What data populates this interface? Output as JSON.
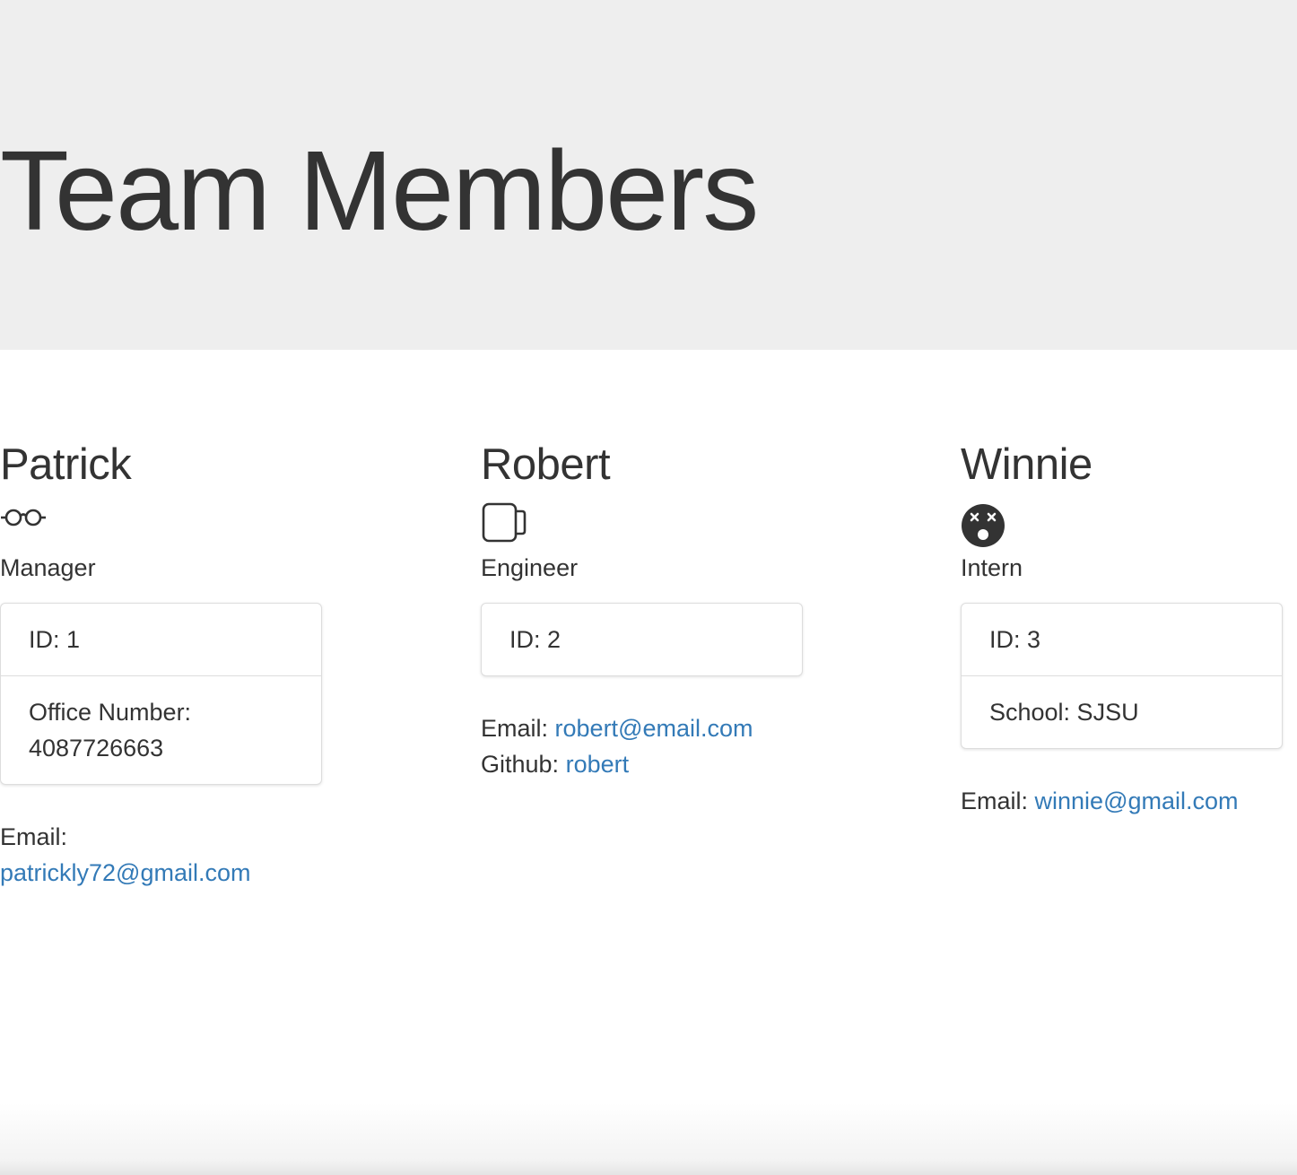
{
  "header": {
    "title": "Team Members"
  },
  "members": [
    {
      "name": "Patrick",
      "icon": "glasses-icon",
      "role": "Manager",
      "info": [
        "ID: 1",
        "Office Number: 4087726663"
      ],
      "email_label": "Email:",
      "email": "patrickly72@gmail.com"
    },
    {
      "name": "Robert",
      "icon": "mug-icon",
      "role": "Engineer",
      "info": [
        "ID: 2"
      ],
      "email_label": "Email:",
      "email": "robert@email.com",
      "github_label": "Github:",
      "github": "robert"
    },
    {
      "name": "Winnie",
      "icon": "dizzy-face-icon",
      "role": "Intern",
      "info": [
        "ID: 3",
        "School: SJSU"
      ],
      "email_label": "Email:",
      "email": "winnie@gmail.com"
    }
  ],
  "colors": {
    "header_background": "#eeeeee",
    "text": "#333333",
    "link": "#337ab7",
    "border": "#dddddd"
  }
}
